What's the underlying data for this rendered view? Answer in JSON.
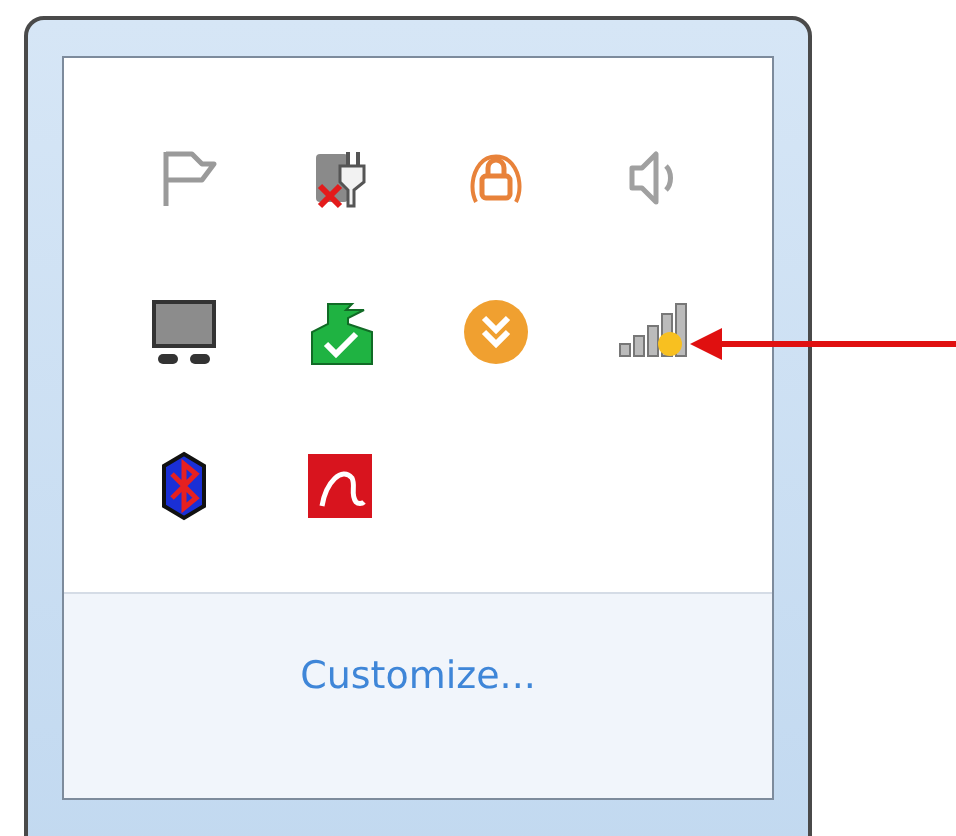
{
  "tray_icons": [
    {
      "kind": "flag"
    },
    {
      "kind": "plug"
    },
    {
      "kind": "lock"
    },
    {
      "kind": "speaker"
    },
    {
      "kind": "display"
    },
    {
      "kind": "flag-check"
    },
    {
      "kind": "double-chevron"
    },
    {
      "kind": "signal"
    },
    {
      "kind": "bluetooth"
    },
    {
      "kind": "swoosh"
    }
  ],
  "customize_link": "Customize..."
}
